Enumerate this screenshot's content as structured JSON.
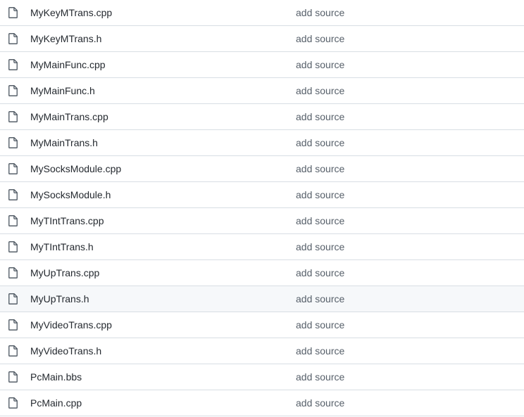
{
  "file_list": {
    "icon": "file-icon",
    "icon_color": "#57606a",
    "hovered_row_index": 11,
    "rows": [
      {
        "name": "MyKeyMTrans.cpp",
        "commit": "add source"
      },
      {
        "name": "MyKeyMTrans.h",
        "commit": "add source"
      },
      {
        "name": "MyMainFunc.cpp",
        "commit": "add source"
      },
      {
        "name": "MyMainFunc.h",
        "commit": "add source"
      },
      {
        "name": "MyMainTrans.cpp",
        "commit": "add source"
      },
      {
        "name": "MyMainTrans.h",
        "commit": "add source"
      },
      {
        "name": "MySocksModule.cpp",
        "commit": "add source"
      },
      {
        "name": "MySocksModule.h",
        "commit": "add source"
      },
      {
        "name": "MyTIntTrans.cpp",
        "commit": "add source"
      },
      {
        "name": "MyTIntTrans.h",
        "commit": "add source"
      },
      {
        "name": "MyUpTrans.cpp",
        "commit": "add source"
      },
      {
        "name": "MyUpTrans.h",
        "commit": "add source"
      },
      {
        "name": "MyVideoTrans.cpp",
        "commit": "add source"
      },
      {
        "name": "MyVideoTrans.h",
        "commit": "add source"
      },
      {
        "name": "PcMain.bbs",
        "commit": "add source"
      },
      {
        "name": "PcMain.cpp",
        "commit": "add source"
      }
    ]
  }
}
